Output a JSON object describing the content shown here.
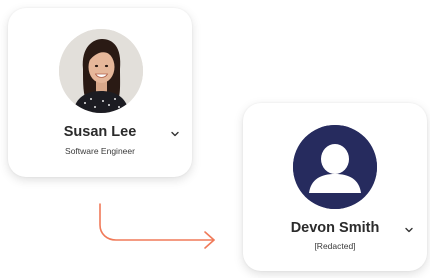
{
  "cards": [
    {
      "name": "Susan Lee",
      "subtitle": "Software Engineer",
      "avatar": "photo-avatar"
    },
    {
      "name": "Devon Smith",
      "subtitle": "[Redacted]",
      "avatar": "user-silhouette-icon"
    }
  ],
  "colors": {
    "placeholder_avatar_bg": "#262b5e",
    "arrow": "#f07a59",
    "card_bg": "#ffffff",
    "text": "#2b2b2b"
  },
  "icons": {
    "dropdown": "chevron-down-icon",
    "connector": "arrow-right-icon"
  }
}
